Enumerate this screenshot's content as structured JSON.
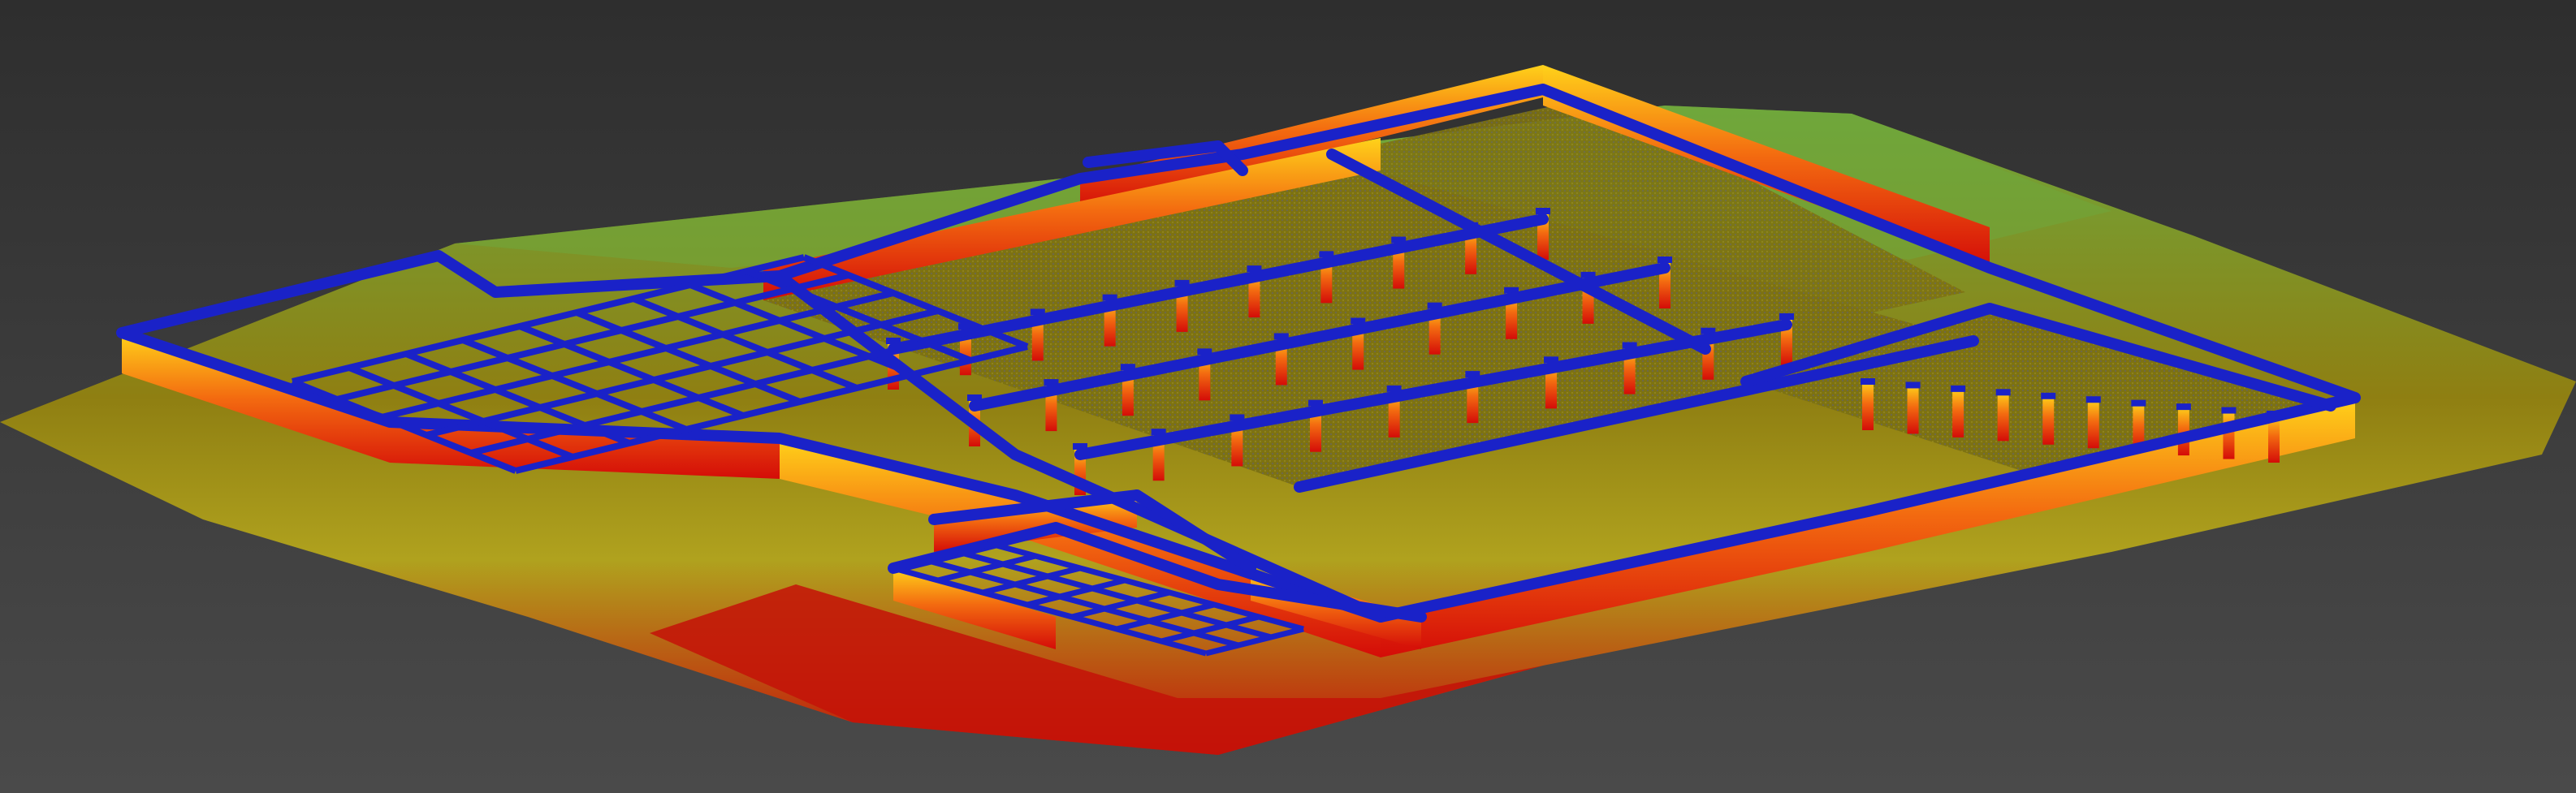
{
  "viewport": {
    "background_top": "#2e2e2e",
    "background_bottom": "#4a4a4a"
  },
  "palette": {
    "ground_low": "#c41208",
    "ground_mid": "#8f7f12",
    "ground_high": "#6fa73c",
    "wall_base": "#d40c08",
    "wall_mid": "#f36a10",
    "wall_top": "#ffd21a",
    "wall_cap": "#1a22c8",
    "floor": "#7d7212"
  }
}
